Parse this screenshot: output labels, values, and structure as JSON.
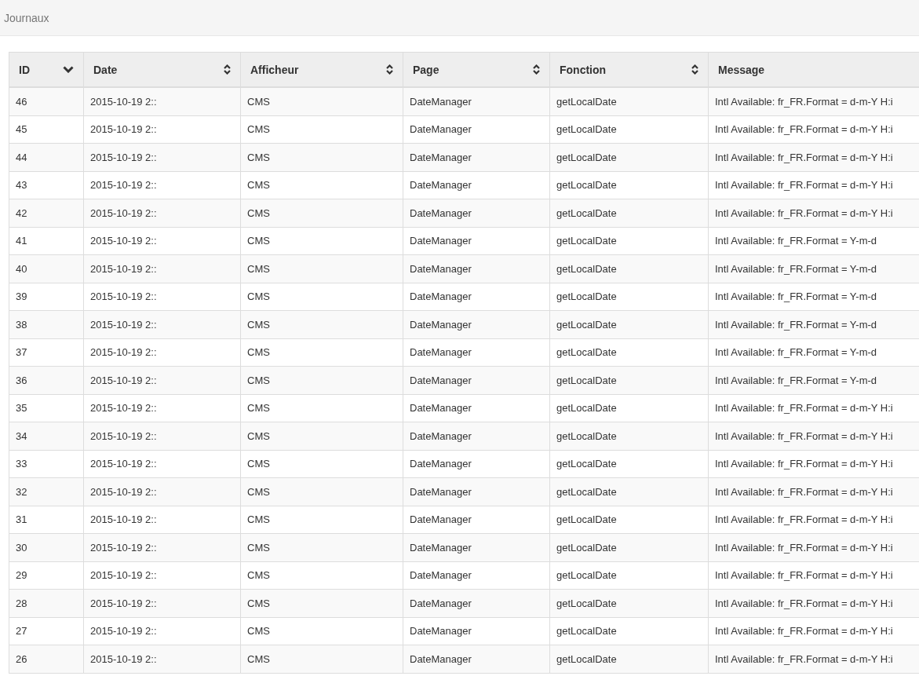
{
  "header": {
    "title": "Journaux"
  },
  "table": {
    "columns": [
      {
        "label": "ID",
        "sortable": true,
        "sorted": true
      },
      {
        "label": "Date",
        "sortable": true,
        "sorted": false
      },
      {
        "label": "Afficheur",
        "sortable": true,
        "sorted": false
      },
      {
        "label": "Page",
        "sortable": true,
        "sorted": false
      },
      {
        "label": "Fonction",
        "sortable": true,
        "sorted": false
      },
      {
        "label": "Message",
        "sortable": false
      }
    ],
    "rows": [
      [
        "46",
        "2015-10-19 2::",
        "CMS",
        "DateManager",
        "getLocalDate",
        "Intl Available: fr_FR.Format = d-m-Y H:i"
      ],
      [
        "45",
        "2015-10-19 2::",
        "CMS",
        "DateManager",
        "getLocalDate",
        "Intl Available: fr_FR.Format = d-m-Y H:i"
      ],
      [
        "44",
        "2015-10-19 2::",
        "CMS",
        "DateManager",
        "getLocalDate",
        "Intl Available: fr_FR.Format = d-m-Y H:i"
      ],
      [
        "43",
        "2015-10-19 2::",
        "CMS",
        "DateManager",
        "getLocalDate",
        "Intl Available: fr_FR.Format = d-m-Y H:i"
      ],
      [
        "42",
        "2015-10-19 2::",
        "CMS",
        "DateManager",
        "getLocalDate",
        "Intl Available: fr_FR.Format = d-m-Y H:i"
      ],
      [
        "41",
        "2015-10-19 2::",
        "CMS",
        "DateManager",
        "getLocalDate",
        "Intl Available: fr_FR.Format = Y-m-d"
      ],
      [
        "40",
        "2015-10-19 2::",
        "CMS",
        "DateManager",
        "getLocalDate",
        "Intl Available: fr_FR.Format = Y-m-d"
      ],
      [
        "39",
        "2015-10-19 2::",
        "CMS",
        "DateManager",
        "getLocalDate",
        "Intl Available: fr_FR.Format = Y-m-d"
      ],
      [
        "38",
        "2015-10-19 2::",
        "CMS",
        "DateManager",
        "getLocalDate",
        "Intl Available: fr_FR.Format = Y-m-d"
      ],
      [
        "37",
        "2015-10-19 2::",
        "CMS",
        "DateManager",
        "getLocalDate",
        "Intl Available: fr_FR.Format = Y-m-d"
      ],
      [
        "36",
        "2015-10-19 2::",
        "CMS",
        "DateManager",
        "getLocalDate",
        "Intl Available: fr_FR.Format = Y-m-d"
      ],
      [
        "35",
        "2015-10-19 2::",
        "CMS",
        "DateManager",
        "getLocalDate",
        "Intl Available: fr_FR.Format = d-m-Y H:i"
      ],
      [
        "34",
        "2015-10-19 2::",
        "CMS",
        "DateManager",
        "getLocalDate",
        "Intl Available: fr_FR.Format = d-m-Y H:i"
      ],
      [
        "33",
        "2015-10-19 2::",
        "CMS",
        "DateManager",
        "getLocalDate",
        "Intl Available: fr_FR.Format = d-m-Y H:i"
      ],
      [
        "32",
        "2015-10-19 2::",
        "CMS",
        "DateManager",
        "getLocalDate",
        "Intl Available: fr_FR.Format = d-m-Y H:i"
      ],
      [
        "31",
        "2015-10-19 2::",
        "CMS",
        "DateManager",
        "getLocalDate",
        "Intl Available: fr_FR.Format = d-m-Y H:i"
      ],
      [
        "30",
        "2015-10-19 2::",
        "CMS",
        "DateManager",
        "getLocalDate",
        "Intl Available: fr_FR.Format = d-m-Y H:i"
      ],
      [
        "29",
        "2015-10-19 2::",
        "CMS",
        "DateManager",
        "getLocalDate",
        "Intl Available: fr_FR.Format = d-m-Y H:i"
      ],
      [
        "28",
        "2015-10-19 2::",
        "CMS",
        "DateManager",
        "getLocalDate",
        "Intl Available: fr_FR.Format = d-m-Y H:i"
      ],
      [
        "27",
        "2015-10-19 2::",
        "CMS",
        "DateManager",
        "getLocalDate",
        "Intl Available: fr_FR.Format = d-m-Y H:i"
      ],
      [
        "26",
        "2015-10-19 2::",
        "CMS",
        "DateManager",
        "getLocalDate",
        "Intl Available: fr_FR.Format = d-m-Y H:i"
      ]
    ]
  }
}
